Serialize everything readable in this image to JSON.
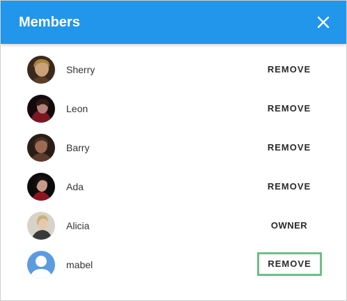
{
  "dialog": {
    "title": "Members",
    "close_icon": "close-icon"
  },
  "members": [
    {
      "name": "Sherry",
      "action": "REMOVE",
      "avatar": "photo"
    },
    {
      "name": "Leon",
      "action": "REMOVE",
      "avatar": "photo"
    },
    {
      "name": "Barry",
      "action": "REMOVE",
      "avatar": "photo"
    },
    {
      "name": "Ada",
      "action": "REMOVE",
      "avatar": "photo"
    },
    {
      "name": "Alicia",
      "action": "OWNER",
      "avatar": "photo"
    },
    {
      "name": "mabel",
      "action": "REMOVE",
      "avatar": "default-user-icon"
    }
  ],
  "colors": {
    "header": "#2196ea",
    "focus_outline": "#6dbf84",
    "default_avatar_bg": "#5b9be0"
  }
}
